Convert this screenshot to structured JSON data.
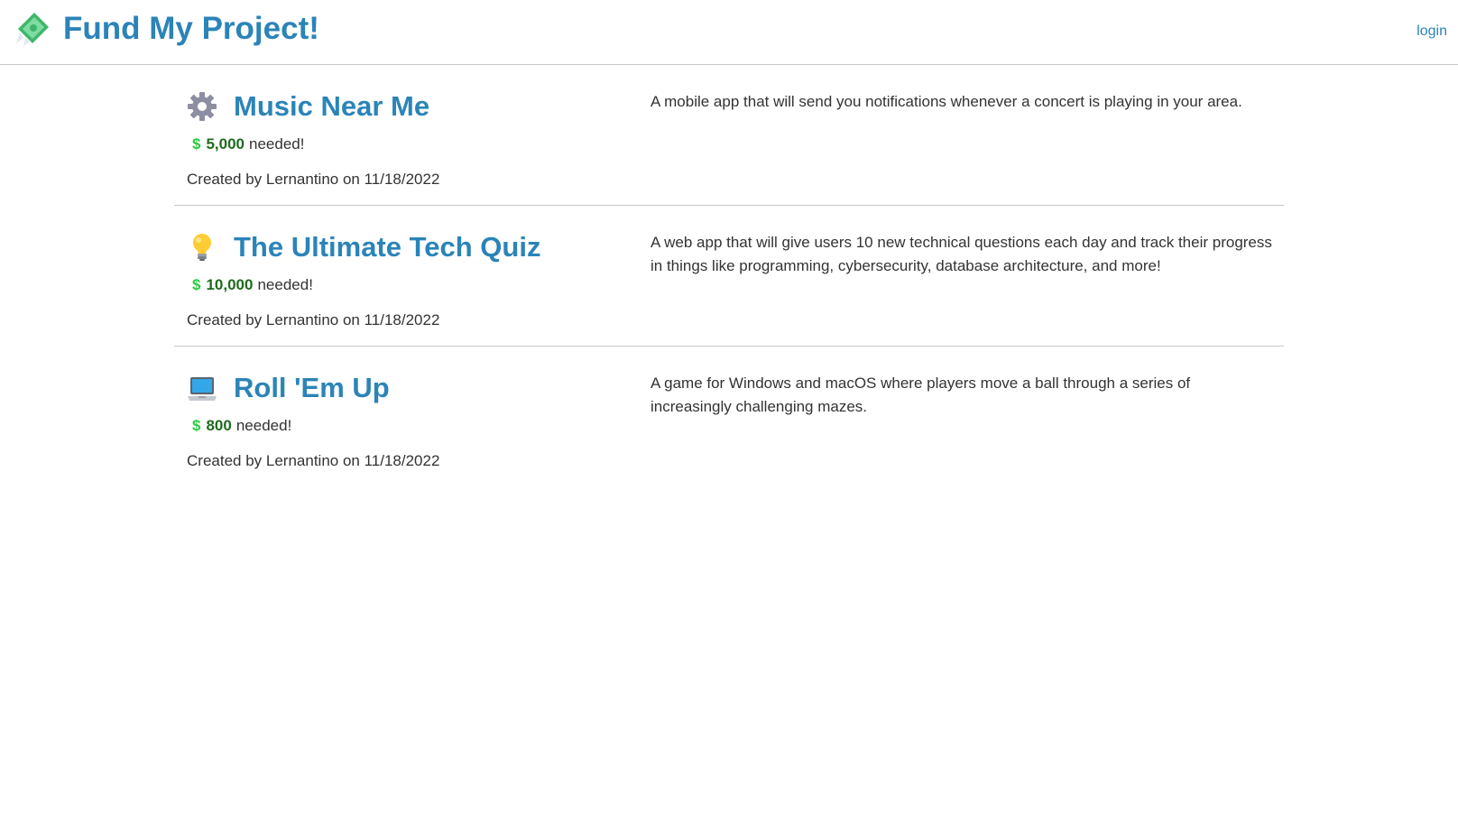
{
  "header": {
    "brand_icon": "money-with-wings-icon",
    "title": "Fund My Project!",
    "login_label": "login"
  },
  "colors": {
    "accent": "#2b84b8",
    "dollar": "#2ecc40",
    "goal_amount": "#1e6b1e",
    "text": "#333333",
    "divider": "#c9c9c9"
  },
  "projects": [
    {
      "icon": "gear-icon",
      "title": "Music Near Me",
      "goal_symbol": "$",
      "goal_amount": "5,000",
      "goal_suffix": "needed!",
      "created": "Created by Lernantino on 11/18/2022",
      "description": "A mobile app that will send you notifications whenever a concert is playing in your area."
    },
    {
      "icon": "lightbulb-icon",
      "title": "The Ultimate Tech Quiz",
      "goal_symbol": "$",
      "goal_amount": "10,000",
      "goal_suffix": "needed!",
      "created": "Created by Lernantino on 11/18/2022",
      "description": "A web app that will give users 10 new technical questions each day and track their progress in things like programming, cybersecurity, database architecture, and more!"
    },
    {
      "icon": "laptop-icon",
      "title": "Roll 'Em Up",
      "goal_symbol": "$",
      "goal_amount": "800",
      "goal_suffix": "needed!",
      "created": "Created by Lernantino on 11/18/2022",
      "description": "A game for Windows and macOS where players move a ball through a series of increasingly challenging mazes."
    }
  ]
}
